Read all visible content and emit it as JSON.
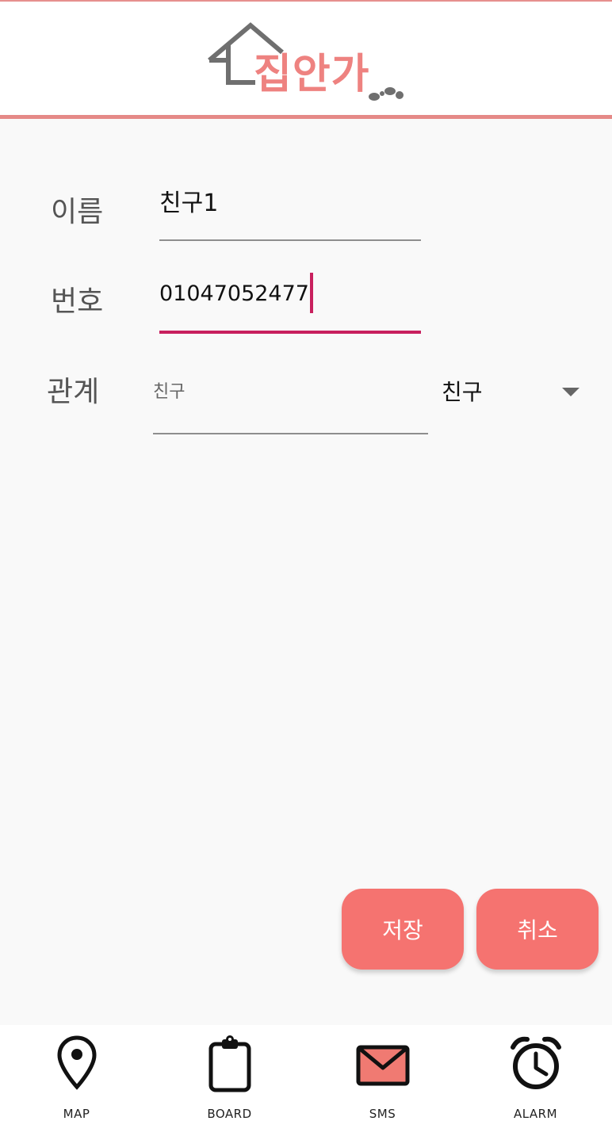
{
  "header": {
    "logo_text": "집안가"
  },
  "form": {
    "name_label": "이름",
    "name_value": "친구1",
    "phone_label": "번호",
    "phone_value": "01047052477",
    "relation_label": "관계",
    "relation_hint": "친구",
    "relation_selected": "친구"
  },
  "actions": {
    "save_label": "저장",
    "cancel_label": "취소"
  },
  "bottom_nav": {
    "items": [
      {
        "label": "MAP",
        "icon": "map-pin-icon"
      },
      {
        "label": "BOARD",
        "icon": "clipboard-icon"
      },
      {
        "label": "SMS",
        "icon": "envelope-icon"
      },
      {
        "label": "ALARM",
        "icon": "alarm-clock-icon"
      }
    ]
  },
  "colors": {
    "brand_pink": "#ee8280",
    "header_line": "#e58987",
    "button": "#f57370",
    "focus_accent": "#c8205e",
    "background": "#f9f9f9"
  }
}
